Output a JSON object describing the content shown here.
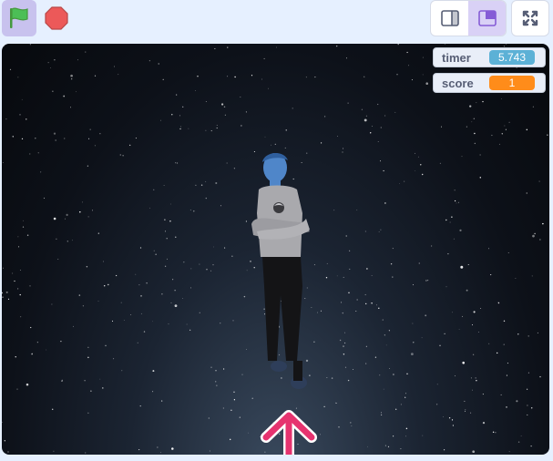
{
  "toolbar": {
    "green_flag_icon": "green-flag-icon",
    "stop_icon": "stop-sign-icon",
    "layout_small_icon": "small-stage-layout-icon",
    "layout_normal_icon": "normal-stage-layout-icon",
    "fullscreen_icon": "fullscreen-icon"
  },
  "monitors": [
    {
      "label": "timer",
      "value": "5.743",
      "color": "#5cb1d6"
    },
    {
      "label": "score",
      "value": "1",
      "color": "#ff8c1a"
    }
  ],
  "stage": {
    "background": "starry night sky",
    "sprites": [
      "person-sprite",
      "up-arrow-sprite"
    ],
    "arrow_color": "#e6336f"
  }
}
